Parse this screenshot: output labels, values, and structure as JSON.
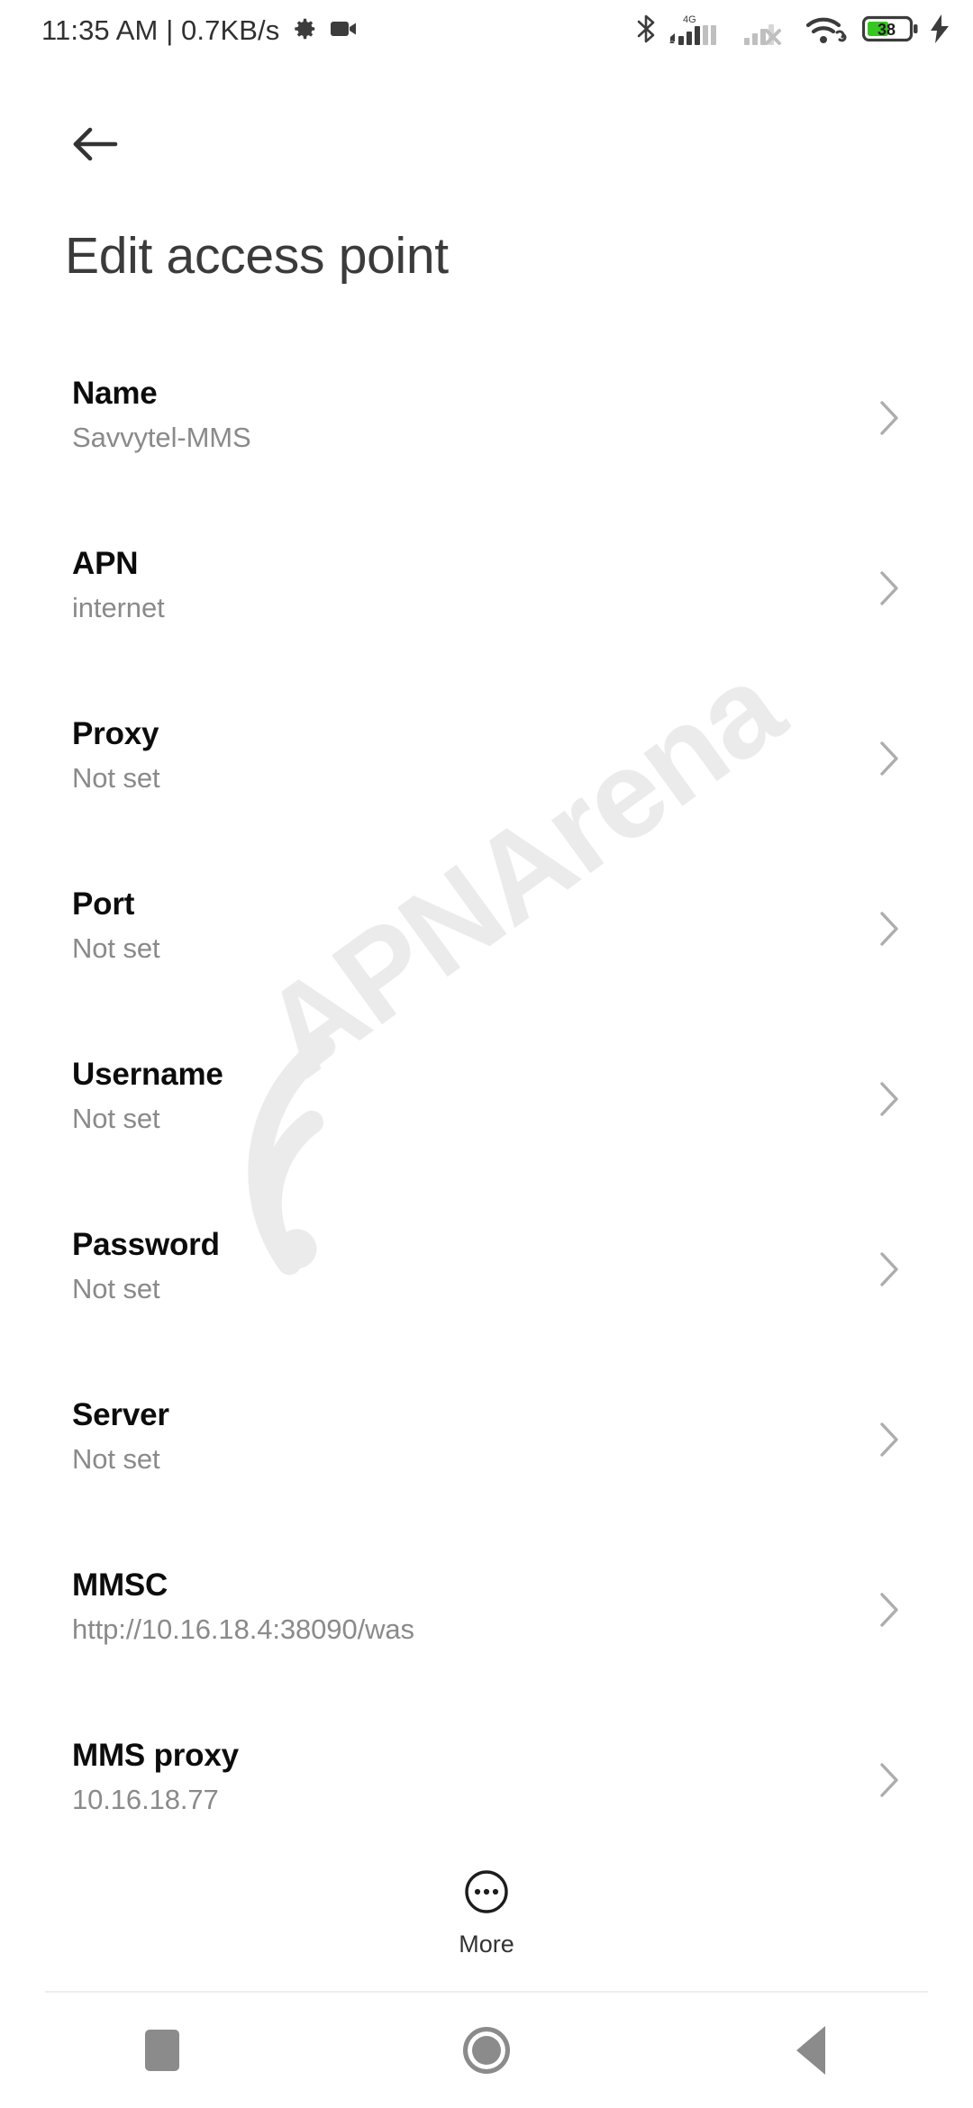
{
  "status_bar": {
    "clock": "11:35 AM | 0.7KB/s",
    "left_icons": [
      "gear-icon",
      "video-camera-icon"
    ],
    "right_icons": [
      "bluetooth-icon",
      "signal-4g-icon",
      "signal-no-service-icon",
      "wifi-icon",
      "battery-icon",
      "charging-bolt-icon"
    ],
    "network_label": "4G",
    "battery_percent": "38",
    "battery_color": "#37c522",
    "icon_color": "#3c3c3c",
    "signal_dim_color": "#b9b9b9"
  },
  "header": {
    "back_icon": "arrow-left-icon",
    "title": "Edit access point"
  },
  "watermark": {
    "text": "APNArena",
    "color": "#ebebeb"
  },
  "list": {
    "chevron_icon": "chevron-right-icon",
    "rows": [
      {
        "title": "Name",
        "value": "Savvytel-MMS"
      },
      {
        "title": "APN",
        "value": "internet"
      },
      {
        "title": "Proxy",
        "value": "Not set"
      },
      {
        "title": "Port",
        "value": "Not set"
      },
      {
        "title": "Username",
        "value": "Not set"
      },
      {
        "title": "Password",
        "value": "Not set"
      },
      {
        "title": "Server",
        "value": "Not set"
      },
      {
        "title": "MMSC",
        "value": "http://10.16.18.4:38090/was"
      },
      {
        "title": "MMS proxy",
        "value": "10.16.18.77"
      }
    ]
  },
  "footer": {
    "more_label": "More",
    "more_icon": "more-circle-icon"
  },
  "nav_bar": {
    "recents_label": "recents-square-icon",
    "home_label": "home-circle-icon",
    "back_label": "back-triangle-icon",
    "color": "#8b8b8b"
  }
}
